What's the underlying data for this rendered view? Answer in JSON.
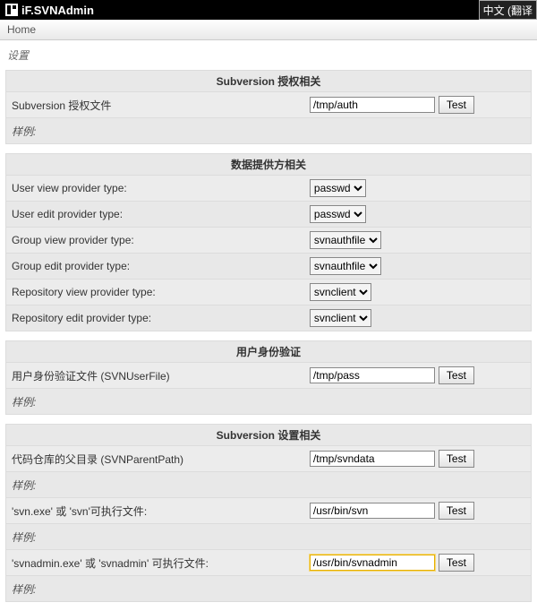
{
  "header": {
    "app_title": "iF.SVNAdmin",
    "lang_button": "中文 (翻译",
    "nav_home": "Home"
  },
  "page_heading": "设置",
  "test_label": "Test",
  "example_label": "样例:",
  "sections": {
    "auth": {
      "title": "Subversion 授权相关",
      "auth_file_label": "Subversion 授权文件",
      "auth_file_value": "/tmp/auth"
    },
    "data_provider": {
      "title": "数据提供方相关",
      "user_view_label": "User view provider type:",
      "user_view_value": "passwd",
      "user_edit_label": "User edit provider type:",
      "user_edit_value": "passwd",
      "group_view_label": "Group view provider type:",
      "group_view_value": "svnauthfile",
      "group_edit_label": "Group edit provider type:",
      "group_edit_value": "svnauthfile",
      "repo_view_label": "Repository view provider type:",
      "repo_view_value": "svnclient",
      "repo_edit_label": "Repository edit provider type:",
      "repo_edit_value": "svnclient"
    },
    "user_auth": {
      "title": "用户身份验证",
      "user_file_label": "用户身份验证文件 (SVNUserFile)",
      "user_file_value": "/tmp/pass"
    },
    "svn_settings": {
      "title": "Subversion 设置相关",
      "parent_path_label": "代码仓库的父目录 (SVNParentPath)",
      "parent_path_value": "/tmp/svndata",
      "svn_exe_label": "'svn.exe' 或 'svn'可执行文件:",
      "svn_exe_value": "/usr/bin/svn",
      "svnadmin_exe_label": "'svnadmin.exe' 或 'svnadmin' 可执行文件:",
      "svnadmin_exe_value": "/usr/bin/svnadmin"
    }
  }
}
